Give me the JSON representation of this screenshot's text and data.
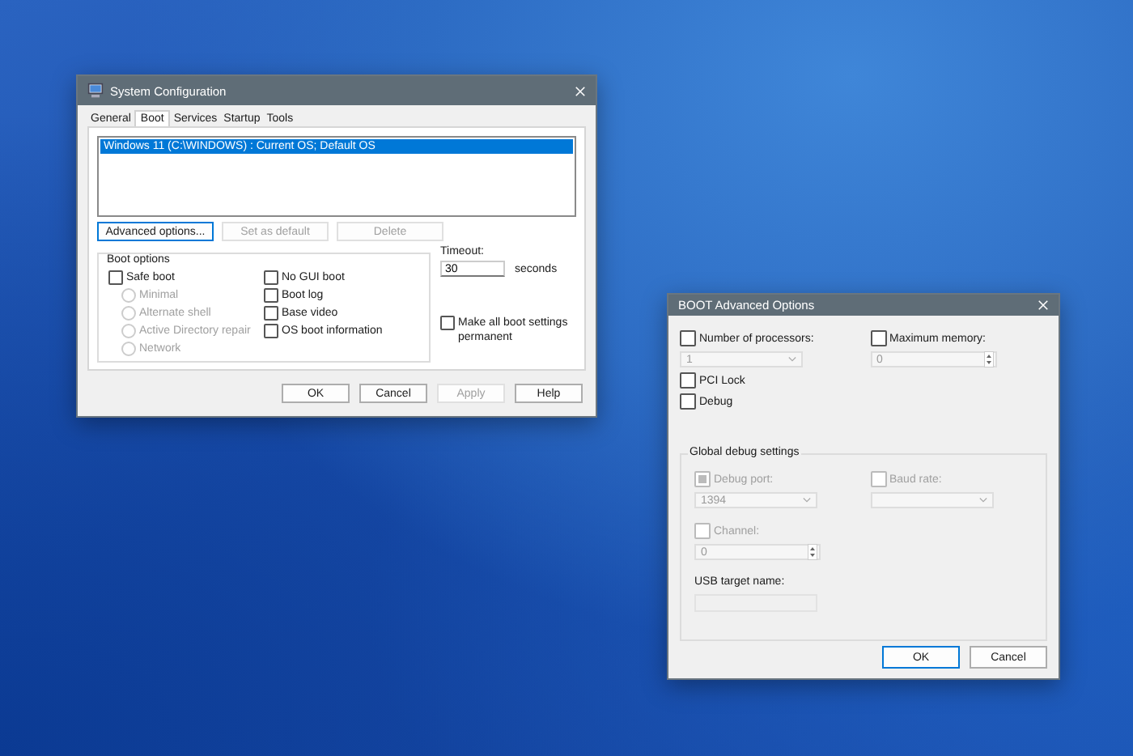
{
  "system_config": {
    "title": "System Configuration",
    "tabs": [
      {
        "label": "General",
        "selected": false
      },
      {
        "label": "Boot",
        "selected": true
      },
      {
        "label": "Services",
        "selected": false
      },
      {
        "label": "Startup",
        "selected": false
      },
      {
        "label": "Tools",
        "selected": false
      }
    ],
    "boot_entries": [
      {
        "label": "Windows 11 (C:\\WINDOWS) : Current OS; Default OS",
        "selected": true
      }
    ],
    "entry_buttons": [
      {
        "label": "Advanced options...",
        "disabled": false
      },
      {
        "label": "Set as default",
        "disabled": true
      },
      {
        "label": "Delete",
        "disabled": true
      }
    ],
    "boot_options": {
      "title": "Boot options",
      "safe_boot": {
        "label": "Safe boot",
        "checked": false
      },
      "safe_modes": [
        {
          "label": "Minimal",
          "selected": false,
          "disabled": true
        },
        {
          "label": "Alternate shell",
          "selected": false,
          "disabled": true
        },
        {
          "label": "Active Directory repair",
          "selected": false,
          "disabled": true
        },
        {
          "label": "Network",
          "selected": false,
          "disabled": true
        }
      ],
      "flags": [
        {
          "label": "No GUI boot",
          "checked": false
        },
        {
          "label": "Boot log",
          "checked": false
        },
        {
          "label": "Base video",
          "checked": false
        },
        {
          "label": "OS boot information",
          "checked": false
        }
      ]
    },
    "timeout": {
      "label": "Timeout:",
      "value": "30",
      "unit": "seconds"
    },
    "permanent": {
      "label": "Make all boot settings permanent",
      "checked": false
    },
    "footer_buttons": [
      {
        "label": "OK",
        "disabled": false
      },
      {
        "label": "Cancel",
        "disabled": false
      },
      {
        "label": "Apply",
        "disabled": true
      },
      {
        "label": "Help",
        "disabled": false
      }
    ]
  },
  "advanced": {
    "title": "BOOT Advanced Options",
    "processors": {
      "label": "Number of processors:",
      "checked": false,
      "value": "1"
    },
    "memory": {
      "label": "Maximum memory:",
      "checked": false,
      "value": "0"
    },
    "pci_lock": {
      "label": "PCI Lock",
      "checked": false
    },
    "debug": {
      "label": "Debug",
      "checked": false
    },
    "global": {
      "title": "Global debug settings",
      "debug_port": {
        "label": "Debug port:",
        "checked": true,
        "value": "1394"
      },
      "baud_rate": {
        "label": "Baud rate:",
        "checked": false
      },
      "channel": {
        "label": "Channel:",
        "checked": false,
        "value": "0"
      },
      "usb_target": {
        "label": "USB target name:"
      }
    },
    "buttons": [
      {
        "label": "OK",
        "primary": true
      },
      {
        "label": "Cancel",
        "primary": false
      }
    ]
  }
}
